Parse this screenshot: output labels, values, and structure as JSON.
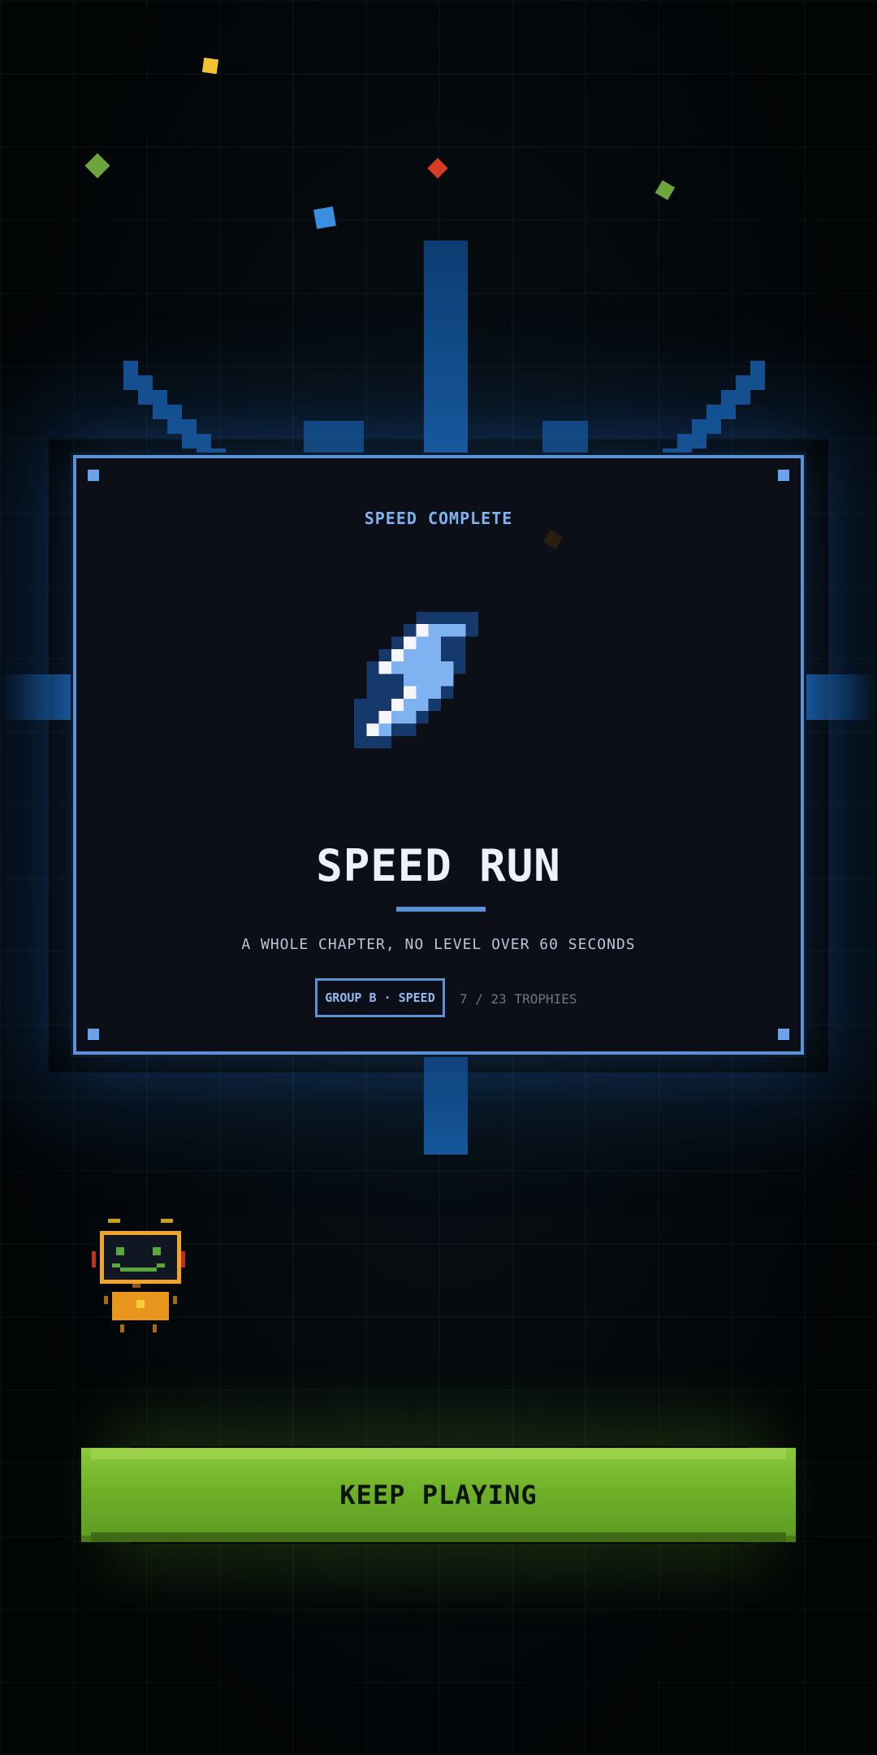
{
  "achievement": {
    "eyebrow": "SPEED COMPLETE",
    "title": "SPEED RUN",
    "description": "A WHOLE CHAPTER, NO LEVEL OVER 60 SECONDS",
    "group_badge": "GROUP B · SPEED",
    "progress_text": "7 / 23 TROPHIES",
    "icon": "lightning-bolt-icon"
  },
  "actions": {
    "continue_label": "KEEP PLAYING"
  },
  "colors": {
    "card_border": "#5d91d6",
    "bolt_light": "#7fb2f0",
    "bolt_dark": "#0f3a6e",
    "cta_green": "#6fb12a",
    "background": "#050a0d"
  }
}
